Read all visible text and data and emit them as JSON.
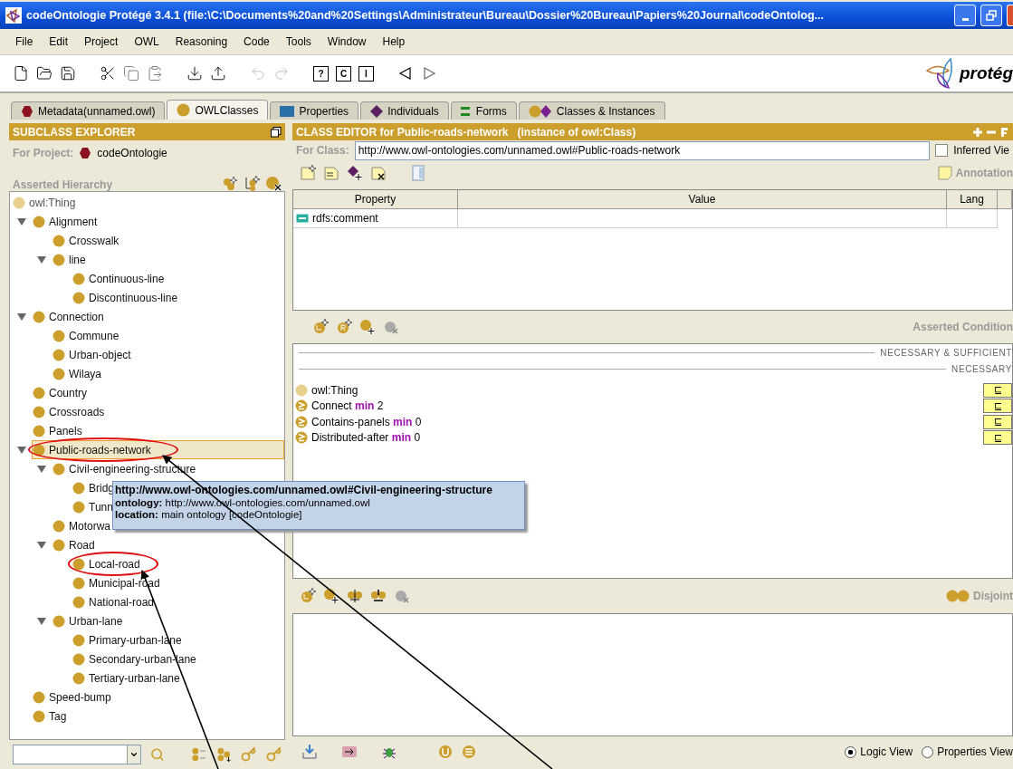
{
  "window": {
    "title": "codeOntologie  Protégé 3.4.1     (file:\\C:\\Documents%20and%20Settings\\Administrateur\\Bureau\\Dossier%20Bureau\\Papiers%20Journal\\codeOntolog..."
  },
  "menu": [
    "File",
    "Edit",
    "Project",
    "OWL",
    "Reasoning",
    "Code",
    "Tools",
    "Window",
    "Help"
  ],
  "toolbar": {
    "query_buttons": [
      "?",
      "C",
      "I"
    ],
    "logo": "protég"
  },
  "tabs": [
    {
      "label": "Metadata(unnamed.owl)",
      "kind": "metadata",
      "selected": false
    },
    {
      "label": "OWLClasses",
      "kind": "classes",
      "selected": true
    },
    {
      "label": "Properties",
      "kind": "properties",
      "selected": false
    },
    {
      "label": "Individuals",
      "kind": "individuals",
      "selected": false
    },
    {
      "label": "Forms",
      "kind": "forms",
      "selected": false
    },
    {
      "label": "Classes & Instances",
      "kind": "instances",
      "selected": false
    }
  ],
  "subclass_explorer": {
    "title": "SUBCLASS EXPLORER",
    "project_label": "For Project:",
    "project": "codeOntologie",
    "hierarchy_label": "Asserted Hierarchy",
    "root": "owl:Thing",
    "tree": [
      {
        "label": "Alignment",
        "expanded": true,
        "selected": false,
        "circled": false,
        "children": [
          {
            "label": "Crosswalk",
            "selected": false,
            "circled": false
          },
          {
            "label": "line",
            "expanded": true,
            "selected": false,
            "circled": false,
            "children": [
              {
                "label": "Continuous-line",
                "selected": false,
                "circled": false
              },
              {
                "label": "Discontinuous-line",
                "selected": false,
                "circled": false
              }
            ]
          }
        ]
      },
      {
        "label": "Connection",
        "expanded": true,
        "selected": false,
        "circled": false,
        "children": [
          {
            "label": "Commune",
            "selected": false,
            "circled": false
          },
          {
            "label": "Urban-object",
            "selected": false,
            "circled": false
          },
          {
            "label": "Wilaya",
            "selected": false,
            "circled": false
          }
        ]
      },
      {
        "label": "Country",
        "selected": false,
        "circled": false
      },
      {
        "label": "Crossroads",
        "selected": false,
        "circled": false
      },
      {
        "label": "Panels",
        "selected": false,
        "circled": false
      },
      {
        "label": "Public-roads-network",
        "expanded": true,
        "selected": true,
        "circled": true,
        "children": [
          {
            "label": "Civil-engineering-structure",
            "expanded": true,
            "selected": false,
            "circled": false,
            "children": [
              {
                "label": "Bridg",
                "selected": false,
                "circled": false
              },
              {
                "label": "Tunn",
                "selected": false,
                "circled": false
              }
            ]
          },
          {
            "label": "Motorwa",
            "selected": false,
            "circled": false
          },
          {
            "label": "Road",
            "expanded": true,
            "selected": false,
            "circled": false,
            "children": [
              {
                "label": "Local-road",
                "selected": false,
                "circled": true
              },
              {
                "label": "Municipal-road",
                "selected": false,
                "circled": false
              },
              {
                "label": "National-road",
                "selected": false,
                "circled": false
              }
            ]
          },
          {
            "label": "Urban-lane",
            "expanded": true,
            "selected": false,
            "circled": false,
            "children": [
              {
                "label": "Primary-urban-lane",
                "selected": false,
                "circled": false
              },
              {
                "label": "Secondary-urban-lane",
                "selected": false,
                "circled": false
              },
              {
                "label": "Tertiary-urban-lane",
                "selected": false,
                "circled": false
              }
            ]
          }
        ]
      },
      {
        "label": "Speed-bump",
        "selected": false,
        "circled": false
      },
      {
        "label": "Tag",
        "selected": false,
        "circled": false
      }
    ],
    "tooltip": {
      "title": "http://www.owl-ontologies.com/unnamed.owl#Civil-engineering-structure",
      "lines": [
        {
          "label": "ontology:",
          "value": "http://www.owl-ontologies.com/unnamed.owl"
        },
        {
          "label": "location:",
          "value": "main ontology [codeOntologie]"
        }
      ]
    }
  },
  "class_editor": {
    "title": "CLASS EDITOR for Public-roads-network   (instance of owl:Class)",
    "for_class_label": "For Class:",
    "for_class": "http://www.owl-ontologies.com/unnamed.owl#Public-roads-network",
    "inferred_view": {
      "label": "Inferred Vie",
      "checked": false
    },
    "annotations_label": "Annotation",
    "table": {
      "columns": [
        "Property",
        "Value",
        "Lang"
      ],
      "rows": [
        {
          "property": "rdfs:comment"
        }
      ]
    },
    "conditions": {
      "title": "Asserted Condition",
      "sections": [
        "NECESSARY & SUFFICIENT",
        "NECESSARY"
      ],
      "rows": [
        {
          "kind": "class",
          "text": "owl:Thing",
          "marker": "⊑"
        },
        {
          "kind": "restriction",
          "text": "Connect",
          "keyword": "min",
          "value": "2",
          "marker": "⊑"
        },
        {
          "kind": "restriction",
          "text": "Contains-panels",
          "keyword": "min",
          "value": "0",
          "marker": "⊑"
        },
        {
          "kind": "restriction",
          "text": "Distributed-after",
          "keyword": "min",
          "value": "0",
          "marker": "⊑"
        }
      ]
    },
    "disjoint": {
      "title": "Disjoint"
    },
    "views": [
      {
        "label": "Logic View",
        "selected": true
      },
      {
        "label": "Properties View",
        "selected": false
      }
    ]
  }
}
